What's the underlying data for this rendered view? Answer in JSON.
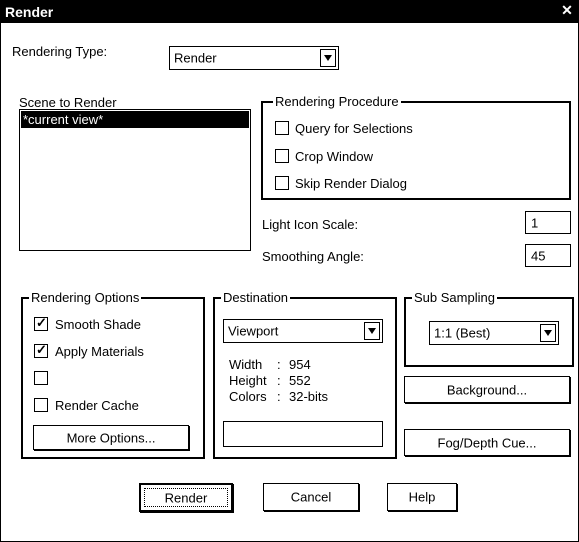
{
  "window": {
    "title": "Render"
  },
  "rendering_type": {
    "label": "Rendering Type:",
    "mnemonic": "R",
    "value": "Render"
  },
  "scene": {
    "label": "Scene to Render",
    "items": [
      "*current view*"
    ]
  },
  "procedure": {
    "title": "Rendering Procedure",
    "items": [
      {
        "label": "Query for Selections",
        "checked": false
      },
      {
        "label": "Crop Window",
        "checked": false
      },
      {
        "label": "Skip Render Dialog",
        "checked": false
      }
    ]
  },
  "light_icon_scale": {
    "label": "Light Icon Scale:",
    "value": "1"
  },
  "smoothing_angle": {
    "label": "Smoothing Angle:",
    "value": "45"
  },
  "options": {
    "title": "Rendering Options",
    "items": [
      {
        "label": "Smooth Shade",
        "checked": true
      },
      {
        "label": "Apply Materials",
        "checked": true
      },
      {
        "label": "",
        "checked": false
      },
      {
        "label": "Render Cache",
        "checked": false
      }
    ],
    "more_button": "More Options..."
  },
  "destination": {
    "title": "Destination",
    "value": "Viewport",
    "width_label": "Width",
    "width_value": "954",
    "height_label": "Height",
    "height_value": "552",
    "colors_label": "Colors",
    "colors_value": "32-bits",
    "separator": ":",
    "field_value": ""
  },
  "subsampling": {
    "title": "Sub Sampling",
    "value": "1:1 (Best)"
  },
  "buttons": {
    "background": "Background...",
    "fog": "Fog/Depth Cue...",
    "render": "Render",
    "cancel": "Cancel",
    "help": "Help"
  }
}
